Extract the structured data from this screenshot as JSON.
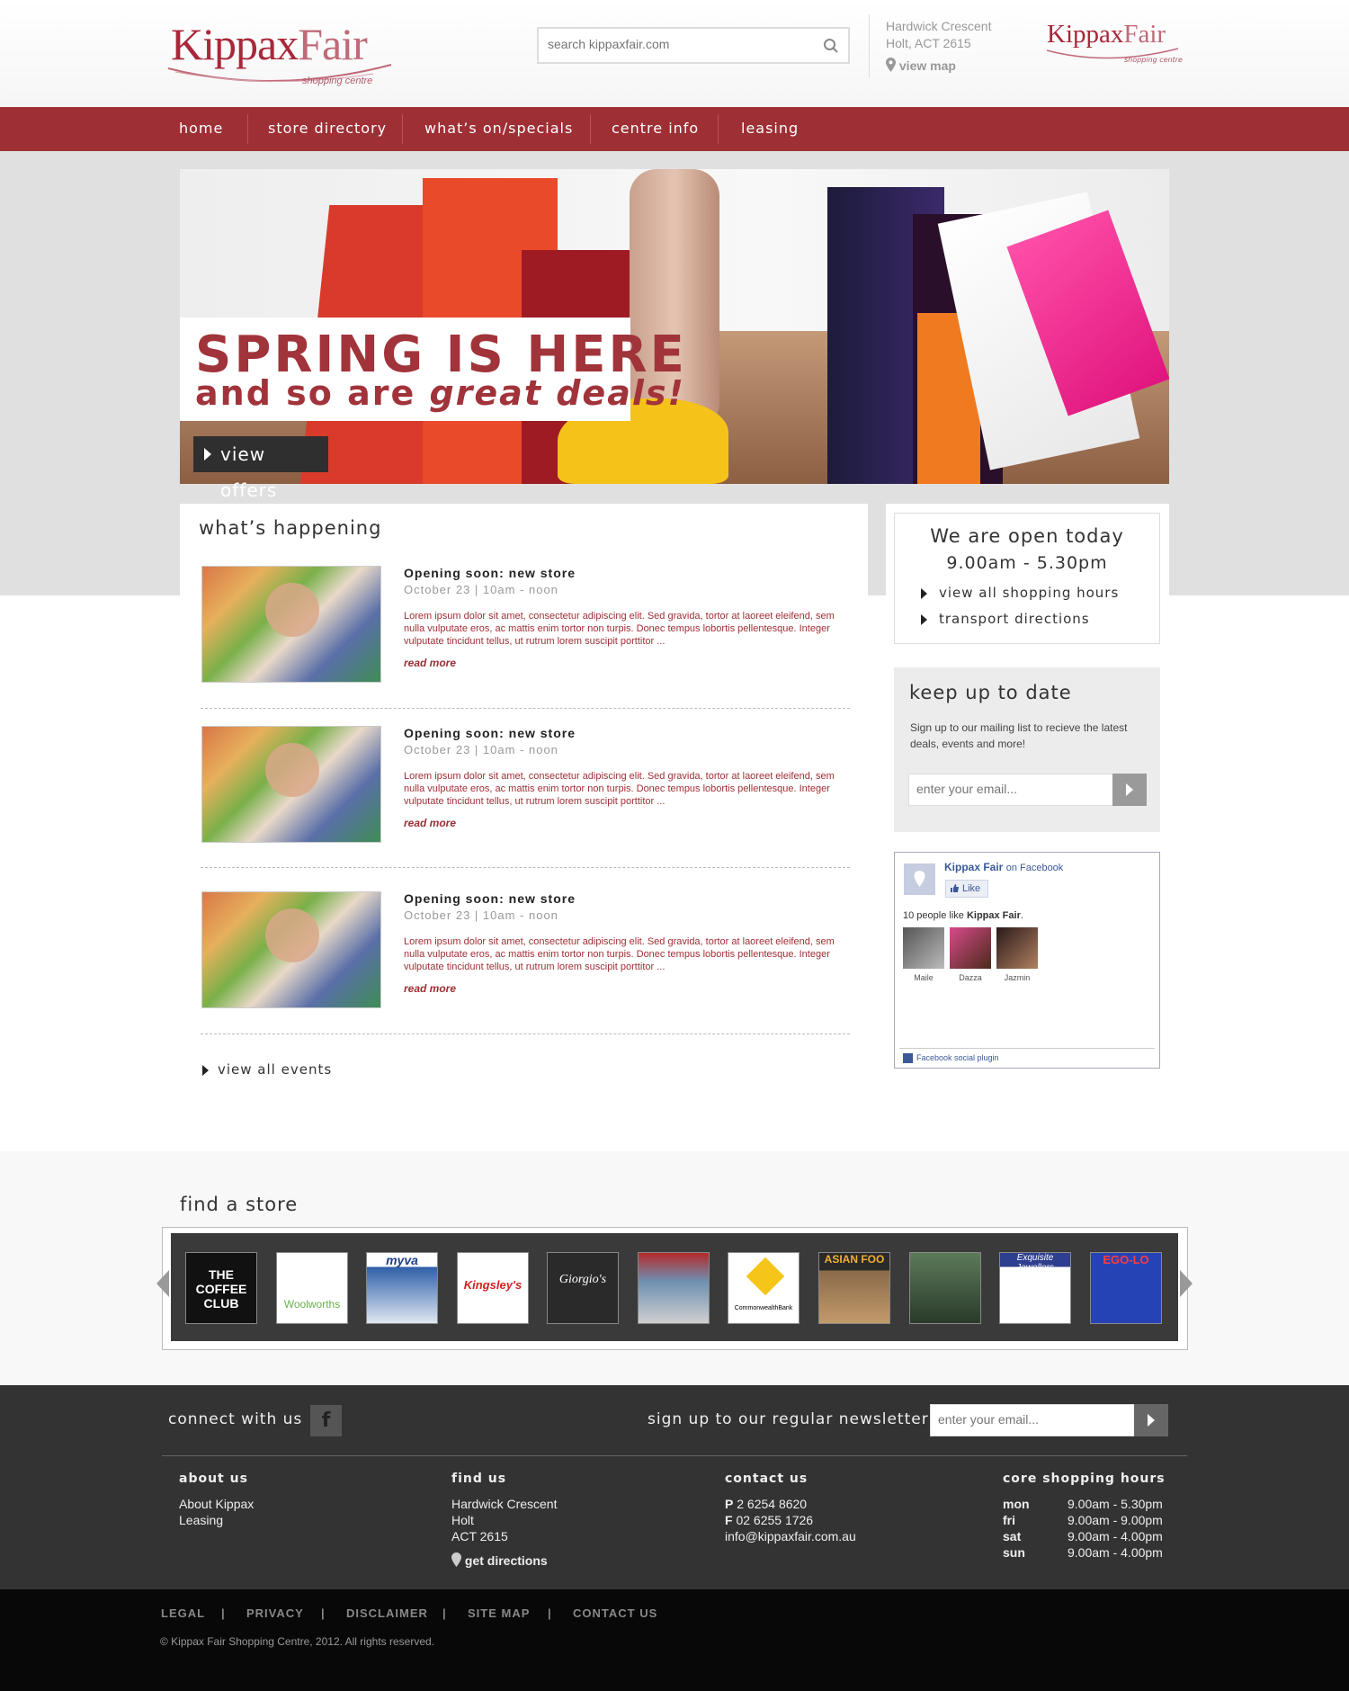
{
  "header": {
    "logo": {
      "kippax": "Kippax",
      "fair": "Fair",
      "subtitle": "shopping centre"
    },
    "search_placeholder": "search kippaxfair.com",
    "address": {
      "line1": "Hardwick Crescent",
      "line2": "Holt, ACT 2615"
    },
    "view_map": "view map"
  },
  "nav": {
    "items": [
      "home",
      "store directory",
      "what’s on/specials",
      "centre info",
      "leasing"
    ]
  },
  "hero": {
    "line1": "SPRING IS HERE",
    "line2_a": "and so are ",
    "line2_b": "great deals!",
    "button": "view offers"
  },
  "happening": {
    "heading": "what’s happening",
    "events": [
      {
        "title": "Opening soon: new store",
        "date": "October 23 | 10am - noon",
        "body": "Lorem ipsum dolor sit amet, consectetur adipiscing elit. Sed gravida, tortor at laoreet eleifend, sem nulla vulputate eros, ac mattis enim tortor non turpis. Donec tempus lobortis pellentesque. Integer vulputate tincidunt tellus, ut rutrum lorem suscipit porttitor ...",
        "more": "read more"
      },
      {
        "title": "Opening soon: new store",
        "date": "October 23 | 10am - noon",
        "body": "Lorem ipsum dolor sit amet, consectetur adipiscing elit. Sed gravida, tortor at laoreet eleifend, sem nulla vulputate eros, ac mattis enim tortor non turpis. Donec tempus lobortis pellentesque. Integer vulputate tincidunt tellus, ut rutrum lorem suscipit porttitor ...",
        "more": "read more"
      },
      {
        "title": "Opening soon: new store",
        "date": "October 23 | 10am - noon",
        "body": "Lorem ipsum dolor sit amet, consectetur adipiscing elit. Sed gravida, tortor at laoreet eleifend, sem nulla vulputate eros, ac mattis enim tortor non turpis. Donec tempus lobortis pellentesque. Integer vulputate tincidunt tellus, ut rutrum lorem suscipit porttitor ...",
        "more": "read more"
      }
    ],
    "view_all": "view all events"
  },
  "open": {
    "title": "We are open today",
    "hours": "9.00am - 5.30pm",
    "links": [
      "view all shopping hours",
      "transport directions"
    ]
  },
  "keep": {
    "heading": "keep up to date",
    "text": "Sign up to our mailing list to recieve the latest deals, events and more!",
    "placeholder": "enter your email..."
  },
  "facebook": {
    "name": "Kippax Fair",
    "on": "on Facebook",
    "like": "Like",
    "count_prefix": "10 people like ",
    "count_name": "Kippax Fair",
    "count_suffix": ".",
    "faces": [
      "Maile",
      "Dazza",
      "Jazmin"
    ],
    "plugin": "Facebook social plugin"
  },
  "stores": {
    "heading": "find a store",
    "logos": [
      "THE COFFEE CLUB",
      "Woolworths",
      "myva",
      "Kingsley's",
      "Giorgio's",
      "",
      "CommonwealthBank",
      "ASIAN FOO",
      "",
      "Exquisite Jewellers",
      "EGO-LO"
    ]
  },
  "footer": {
    "connect": "connect with us",
    "fb": "f",
    "newsletter": "sign up to our regular newsletter",
    "placeholder": "enter your email...",
    "about": {
      "heading": "about us",
      "links": [
        "About Kippax",
        "Leasing"
      ]
    },
    "find": {
      "heading": "find us",
      "lines": [
        "Hardwick Crescent",
        "Holt",
        "ACT 2615"
      ],
      "directions": "get directions"
    },
    "contact": {
      "heading": "contact us",
      "p": "2 6254 8620",
      "f": "02 6255 1726",
      "email": "info@kippaxfair.com.au"
    },
    "hours": {
      "heading": "core shopping hours",
      "rows": [
        {
          "day": "mon",
          "time": "9.00am - 5.30pm"
        },
        {
          "day": "fri",
          "time": "9.00am - 9.00pm"
        },
        {
          "day": "sat",
          "time": "9.00am - 4.00pm"
        },
        {
          "day": "sun",
          "time": "9.00am - 4.00pm"
        }
      ]
    }
  },
  "bottom": {
    "links": [
      "LEGAL",
      "PRIVACY",
      "DISCLAIMER",
      "SITE MAP",
      "CONTACT US"
    ],
    "copyright": "© Kippax Fair Shopping Centre, 2012. All rights reserved."
  },
  "colors": {
    "brand": "#9e2f35",
    "footer": "#333333",
    "bottom": "#080808"
  }
}
